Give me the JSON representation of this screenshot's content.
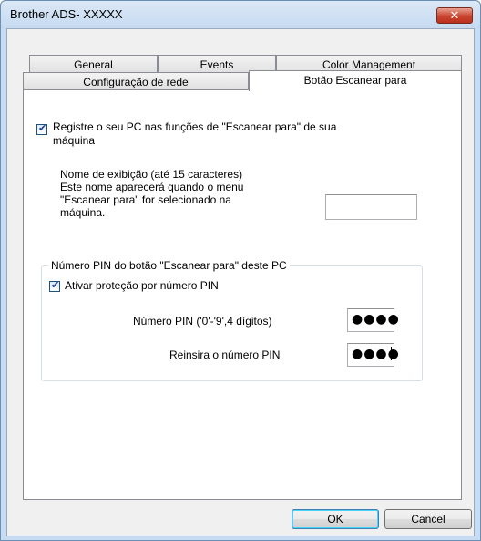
{
  "window": {
    "title": "Brother ADS- XXXXX",
    "close_glyph": "✕"
  },
  "tabs": {
    "row1": [
      "General",
      "Events",
      "Color Management"
    ],
    "row2": [
      "Configuração de rede",
      "Botão Escanear para"
    ],
    "active": "Botão Escanear para"
  },
  "register": {
    "checked": true,
    "label_line1": "Registre o seu PC nas funções de \"Escanear para\" de sua",
    "label_line2": "máquina"
  },
  "display_name": {
    "line1": "Nome de exibição (até 15 caracteres)",
    "line2": "Este nome aparecerá quando o menu",
    "line3": "\"Escanear para\" for selecionado na",
    "line4": "máquina.",
    "value": ""
  },
  "pin_group": {
    "title": "Número PIN do botão \"Escanear para\" deste PC",
    "protect_checked": true,
    "protect_label": "Ativar proteção por número PIN",
    "pin_label": "Número PIN ('0'-'9',4 dígitos)",
    "pin_value": "●●●●",
    "reenter_label": "Reinsira o número PIN",
    "reenter_value": "●●●●"
  },
  "buttons": {
    "ok": "OK",
    "cancel": "Cancel"
  }
}
